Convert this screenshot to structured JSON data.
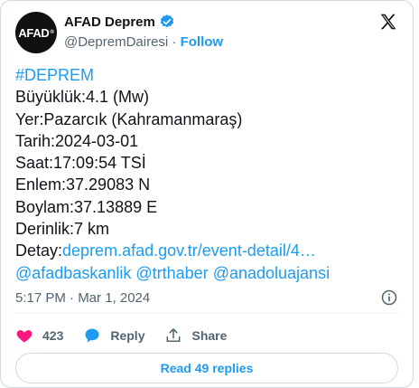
{
  "account": {
    "avatar_text": "AFAD",
    "avatar_mark": "®",
    "display_name": "AFAD Deprem",
    "handle": "@DepremDairesi",
    "separator": "·",
    "follow_label": "Follow"
  },
  "tweet": {
    "hashtag": "#DEPREM",
    "lines": [
      "Büyüklük:4.1 (Mw)",
      "Yer:Pazarcık (Kahramanmaraş)",
      "Tarih:2024-03-01",
      "Saat:17:09:54 TSİ",
      "Enlem:37.29083 N",
      "Boylam:37.13889 E",
      "Derinlik:7 km"
    ],
    "detail_label": "Detay:",
    "detail_link": "deprem.afad.gov.tr/event-detail/4…",
    "mentions": [
      "@afadbaskanlik",
      "@trthaber",
      "@anadoluajansi"
    ]
  },
  "meta": {
    "timestamp": "5:17 PM · Mar 1, 2024"
  },
  "actions": {
    "likes": "423",
    "reply_label": "Reply",
    "share_label": "Share"
  },
  "read_replies_label": "Read 49 replies",
  "icons": {
    "verified": "verified-badge-icon",
    "x_logo": "x-logo-icon",
    "info": "info-icon",
    "heart": "heart-icon",
    "reply": "reply-bubble-icon",
    "share": "share-upload-icon"
  },
  "colors": {
    "accent": "#1d9bf0",
    "heart": "#f91880",
    "muted": "#536471",
    "text": "#0f1419",
    "border": "#cfd9de"
  }
}
